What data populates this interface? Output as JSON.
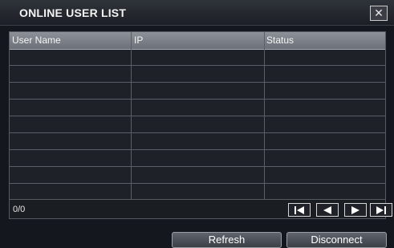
{
  "window": {
    "title": "ONLINE USER LIST",
    "close_symbol": "✕"
  },
  "table": {
    "columns": [
      "User Name",
      "IP",
      "Status"
    ],
    "rows": []
  },
  "footer": {
    "count": "0/0"
  },
  "buttons": {
    "refresh": "Refresh",
    "disconnect": "Disconnect"
  },
  "icons": [
    "close-icon",
    "first-page-icon",
    "previous-page-icon",
    "next-page-icon",
    "last-page-icon"
  ]
}
